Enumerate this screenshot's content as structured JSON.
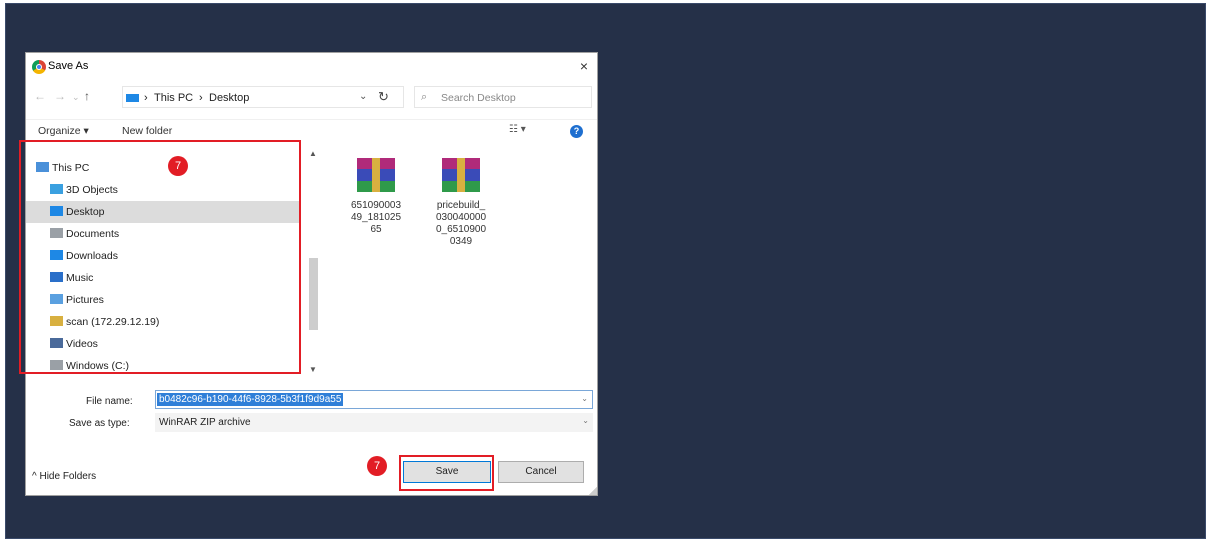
{
  "dialog": {
    "title": "Save As",
    "close_glyph": "×"
  },
  "nav": {
    "back": "←",
    "forward": "→",
    "recent": "⌄",
    "up": "↑",
    "breadcrumb": [
      "This PC",
      "Desktop"
    ],
    "breadcrumb_sep": "›",
    "refresh": "↻",
    "search_placeholder": "Search Desktop"
  },
  "toolbar": {
    "organize": "Organize ▾",
    "new_folder": "New folder"
  },
  "tree": [
    {
      "label": "This PC",
      "icon": "pc-icon",
      "color": "#4a90d9",
      "selected": false
    },
    {
      "label": "3D Objects",
      "icon": "cube-icon",
      "color": "#3aa0e0",
      "selected": false
    },
    {
      "label": "Desktop",
      "icon": "desktop-icon",
      "color": "#1e88e5",
      "selected": true
    },
    {
      "label": "Documents",
      "icon": "document-icon",
      "color": "#9aa0a6",
      "selected": false
    },
    {
      "label": "Downloads",
      "icon": "download-icon",
      "color": "#1e88e5",
      "selected": false
    },
    {
      "label": "Music",
      "icon": "music-icon",
      "color": "#2a6fc9",
      "selected": false
    },
    {
      "label": "Pictures",
      "icon": "pictures-icon",
      "color": "#5aa0e0",
      "selected": false
    },
    {
      "label": "scan (172.29.12.19)",
      "icon": "network-drive-icon",
      "color": "#d8b040",
      "selected": false
    },
    {
      "label": "Videos",
      "icon": "video-icon",
      "color": "#4a6a9a",
      "selected": false
    },
    {
      "label": "Windows (C:)",
      "icon": "drive-icon",
      "color": "#9aa0a6",
      "selected": false
    }
  ],
  "files": [
    {
      "name": "65109000349_18102565",
      "lines": [
        "651090003",
        "49_181025",
        "65"
      ],
      "icon": "winrar-archive-icon"
    },
    {
      "name": "pricebuild_0300400000_65109000349",
      "lines": [
        "pricebuild_",
        "030040000",
        "0_6510900",
        "0349"
      ],
      "icon": "winrar-archive-icon"
    }
  ],
  "form": {
    "file_name_label": "File name:",
    "file_name_value": "b0482c96-b190-44f6-8928-5b3f1f9d9a55",
    "type_label": "Save as type:",
    "type_value": "WinRAR ZIP archive"
  },
  "footer": {
    "hide_folders": "^ Hide Folders",
    "save": "Save",
    "cancel": "Cancel"
  },
  "annotations": {
    "marker_1": "7",
    "marker_2": "7",
    "highlight_color": "#e21d25"
  }
}
